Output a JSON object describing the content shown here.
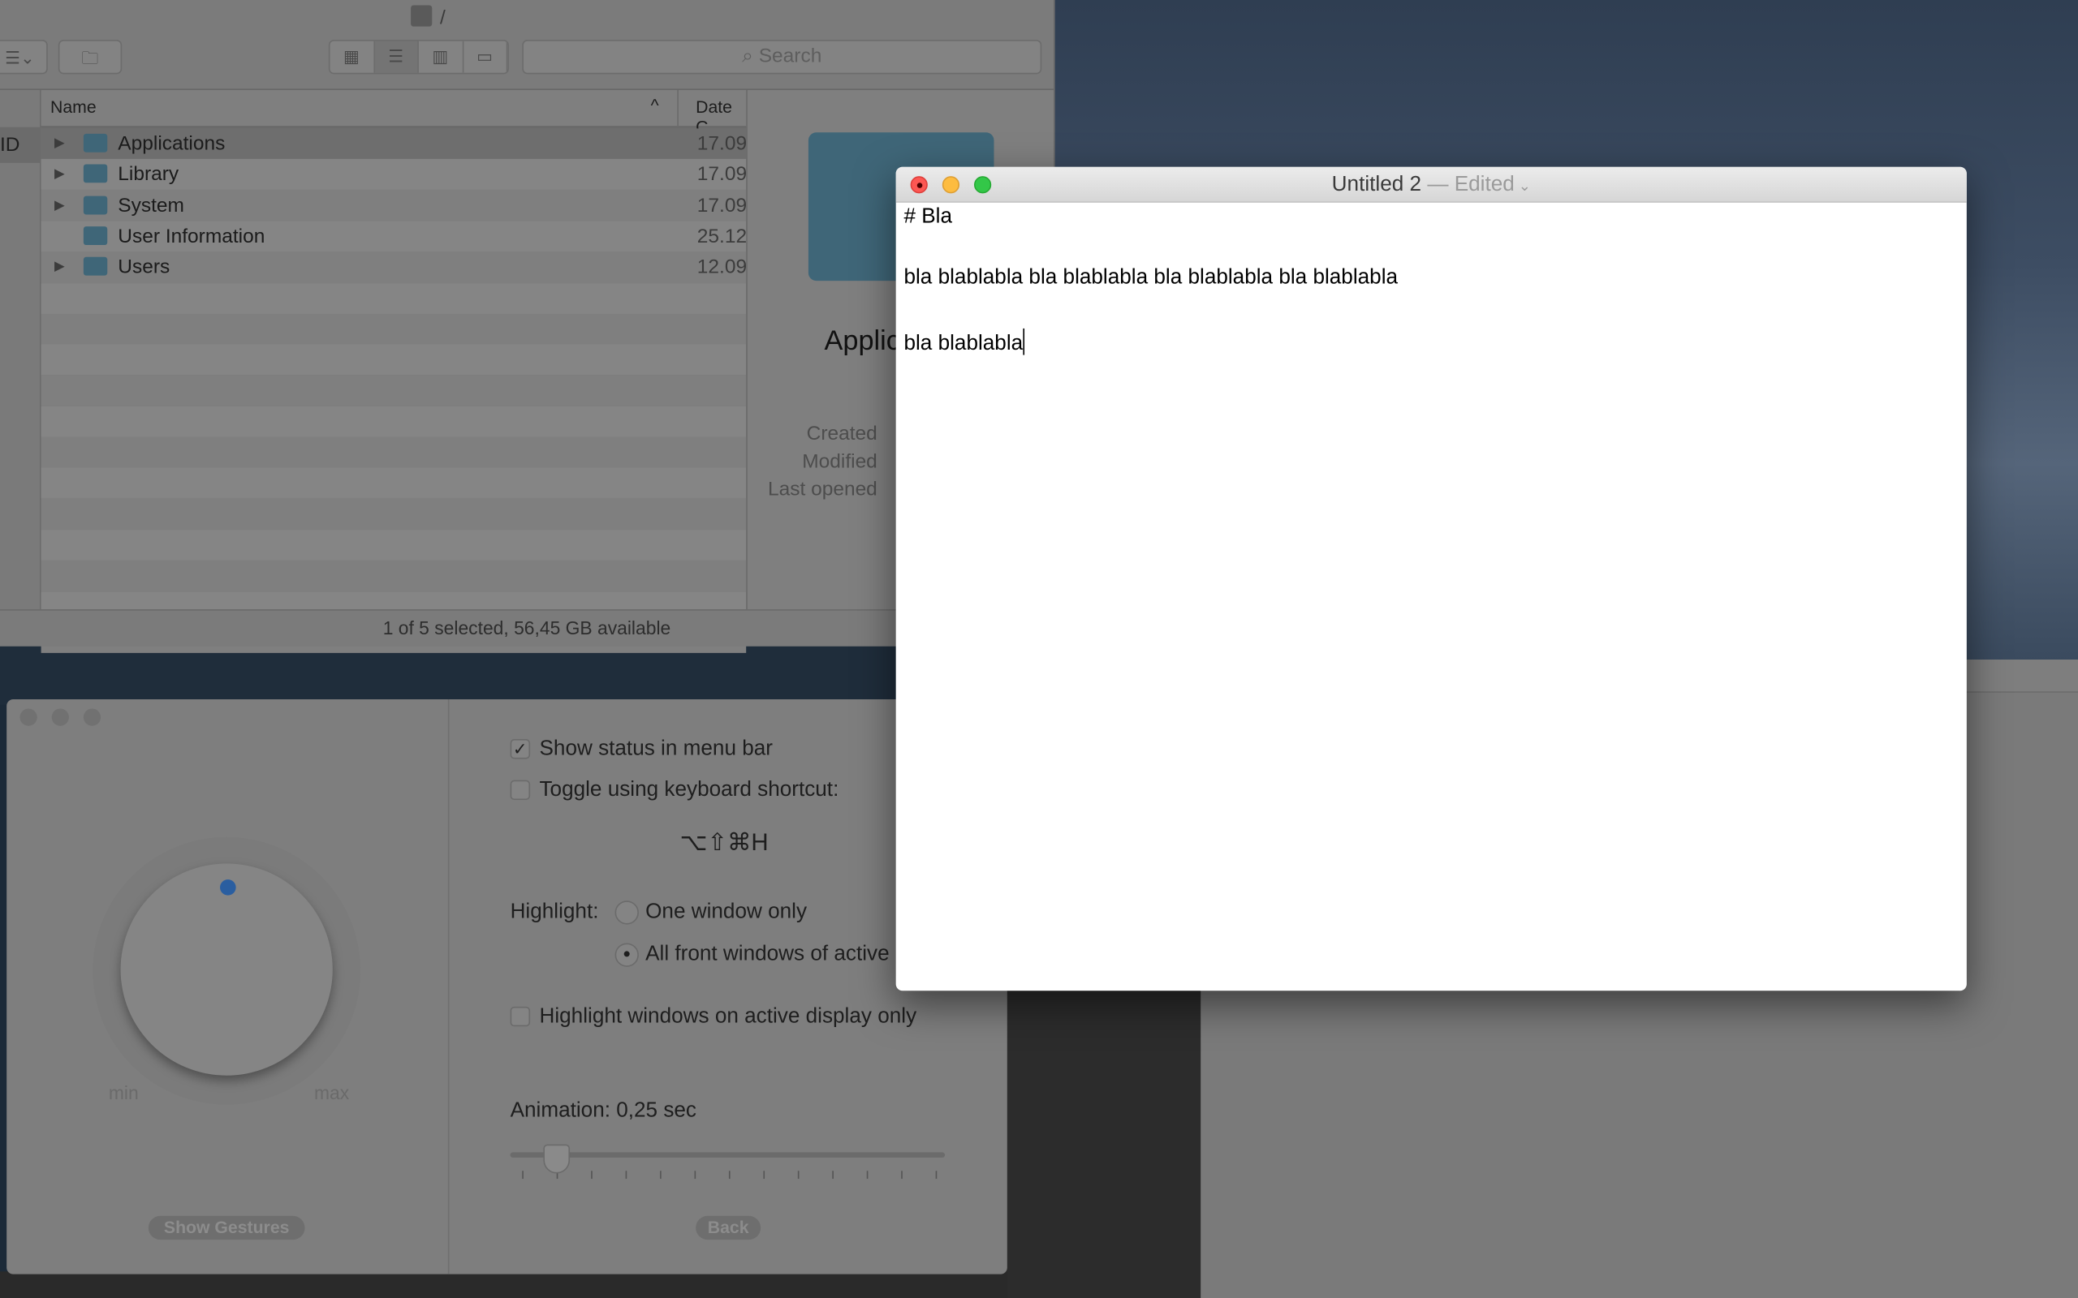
{
  "finder": {
    "path": "/",
    "search_placeholder": "Search",
    "columns": {
      "name": "Name",
      "date": "Date C"
    },
    "sidebar_selected": "ID",
    "rows": [
      {
        "name": "Applications",
        "date": "17.09",
        "expandable": true,
        "selected": true
      },
      {
        "name": "Library",
        "date": "17.09",
        "expandable": true
      },
      {
        "name": "System",
        "date": "17.09",
        "expandable": true
      },
      {
        "name": "User Information",
        "date": "25.12",
        "expandable": false
      },
      {
        "name": "Users",
        "date": "12.09",
        "expandable": true
      }
    ],
    "preview": {
      "title": "Applic",
      "created_label": "Created",
      "modified_label": "Modified",
      "last_opened_label": "Last opened"
    },
    "status": "1 of 5 selected, 56,45 GB available"
  },
  "prefs": {
    "show_status": {
      "label": "Show status in menu bar",
      "checked": true
    },
    "toggle_shortcut": {
      "label": "Toggle using keyboard shortcut:",
      "checked": false
    },
    "shortcut": "⌥⇧⌘H",
    "highlight_label": "Highlight:",
    "highlight_options": [
      {
        "label": "One window only",
        "selected": false
      },
      {
        "label": "All front windows of active",
        "selected": true
      }
    ],
    "active_display": {
      "label": "Highlight windows on active display only",
      "checked": false
    },
    "animation_label": "Animation: 0,25 sec",
    "animation_value_sec": 0.25,
    "knob": {
      "min_label": "min",
      "max_label": "max"
    },
    "show_gestures": "Show Gestures",
    "back": "Back"
  },
  "textedit": {
    "title": "Untitled 2",
    "separator": "—",
    "status": "Edited",
    "lines": [
      "# Bla",
      "bla blablabla bla blablabla bla blablabla bla blablabla",
      "bla blablabla"
    ],
    "colors": {
      "close": "#fc5753",
      "minimize": "#fdbc40",
      "zoom": "#33c748"
    }
  }
}
